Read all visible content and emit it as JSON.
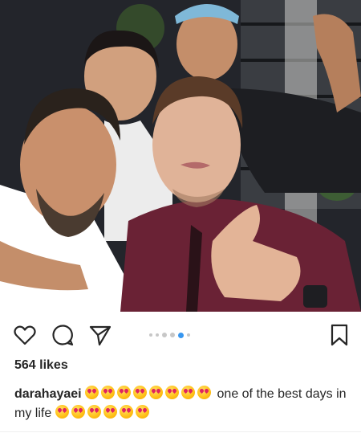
{
  "post": {
    "image_alt": "Group selfie of four men",
    "likes_text": "564 likes",
    "username": "darahayaei",
    "caption_text": "one of the best days in my life",
    "caption_emoji": "heart-eyes-emoji",
    "carousel": {
      "total_dots": 6,
      "active_index": 4
    }
  },
  "icons": {
    "like": "heart-icon",
    "comment": "comment-bubble-icon",
    "share": "paper-plane-icon",
    "save": "bookmark-icon"
  },
  "colors": {
    "text": "#262626",
    "active_dot": "#3897f0",
    "inactive_dot": "#c7c7c7",
    "shirt": "#6a2235"
  }
}
